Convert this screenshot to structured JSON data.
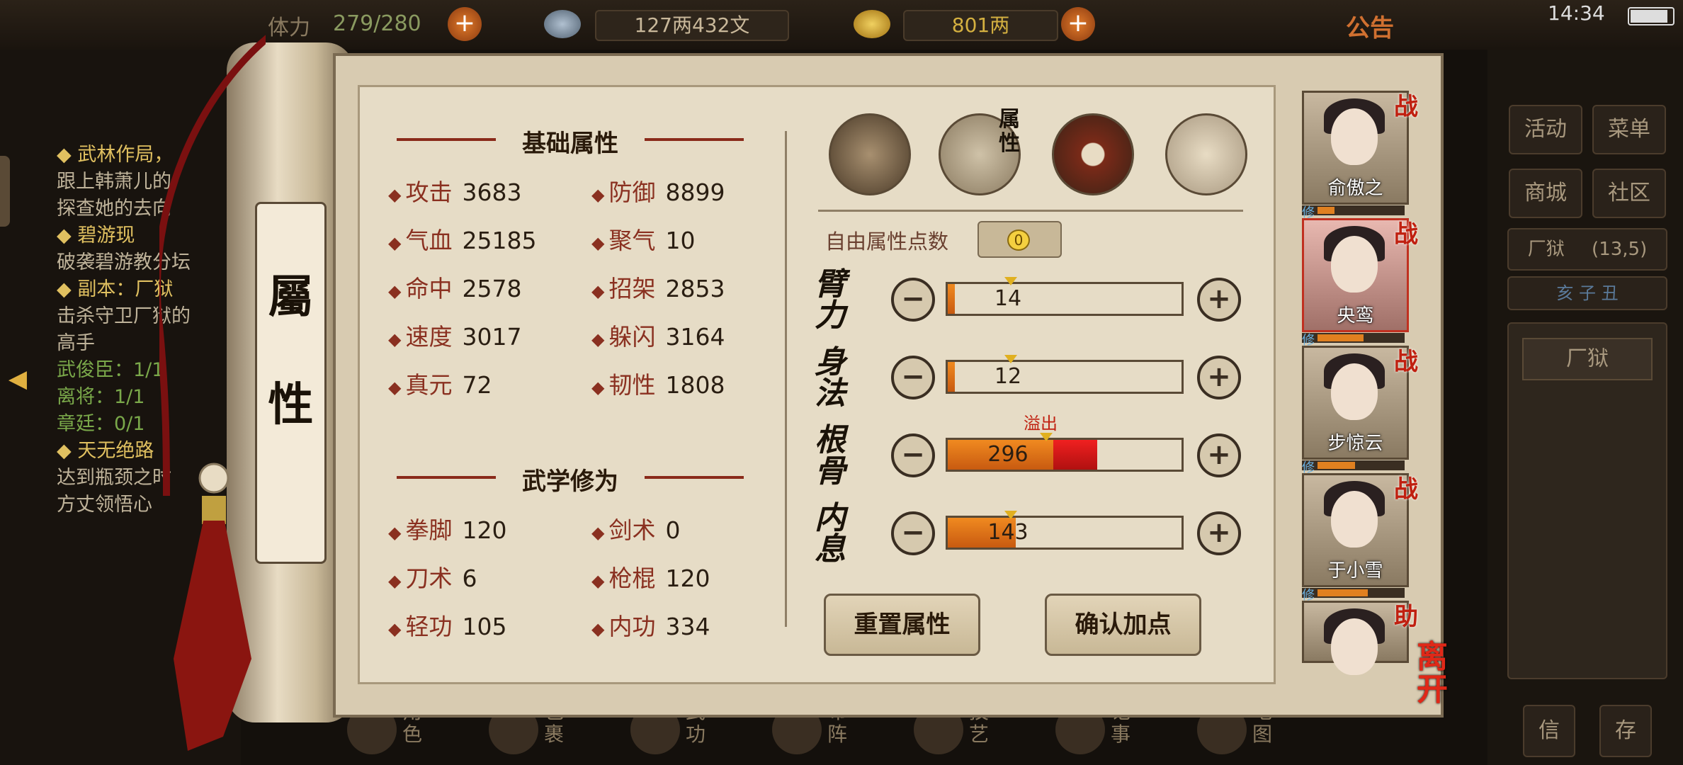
{
  "topbar": {
    "stamina": "279/280",
    "stamina_prefix": "体力",
    "money": "127两432文",
    "gold": "801两",
    "notice": "公告",
    "time": "14:34"
  },
  "bg_log": {
    "lines": [
      {
        "text": "◆ 武林作局，",
        "style": "gold"
      },
      {
        "text": "跟上韩萧儿的",
        "style": "normal"
      },
      {
        "text": "探查她的去向",
        "style": "normal"
      },
      {
        "text": "◆ 碧游现",
        "style": "gold"
      },
      {
        "text": "破袭碧游教分坛",
        "style": "normal"
      },
      {
        "text": "◆ 副本：厂狱",
        "style": "gold"
      },
      {
        "text": "击杀守卫厂狱的",
        "style": "normal"
      },
      {
        "text": "高手",
        "style": "normal"
      },
      {
        "text": "武俊臣：1/1",
        "style": "green"
      },
      {
        "text": "离将：1/1",
        "style": "green"
      },
      {
        "text": "章廷：0/1",
        "style": "green"
      },
      {
        "text": "◆ 天无绝路",
        "style": "gold"
      },
      {
        "text": "达到瓶颈之时",
        "style": "normal"
      },
      {
        "text": "方丈领悟心",
        "style": "normal"
      }
    ]
  },
  "bg_right": {
    "activity": "活动",
    "menu": "菜单",
    "shop": "商城",
    "community": "社区",
    "location": "厂狱",
    "coords": "(13,5)",
    "time_row": "亥 子 丑",
    "map_label": "厂狱",
    "btn_a": "信",
    "btn_b": "存"
  },
  "scroll": {
    "char1": "屬",
    "char2": "性"
  },
  "basic": {
    "title": "基础属性",
    "stats": [
      {
        "name": "攻击",
        "value": "3683"
      },
      {
        "name": "防御",
        "value": "8899"
      },
      {
        "name": "气血",
        "value": "25185"
      },
      {
        "name": "聚气",
        "value": "10"
      },
      {
        "name": "命中",
        "value": "2578"
      },
      {
        "name": "招架",
        "value": "2853"
      },
      {
        "name": "速度",
        "value": "3017"
      },
      {
        "name": "躲闪",
        "value": "3164"
      },
      {
        "name": "真元",
        "value": "72"
      },
      {
        "name": "韧性",
        "value": "1808"
      }
    ]
  },
  "martial": {
    "title": "武学修为",
    "stats": [
      {
        "name": "拳脚",
        "value": "120"
      },
      {
        "name": "剑术",
        "value": "0"
      },
      {
        "name": "刀术",
        "value": "6"
      },
      {
        "name": "枪棍",
        "value": "120"
      },
      {
        "name": "轻功",
        "value": "105"
      },
      {
        "name": "内功",
        "value": "334"
      }
    ]
  },
  "tabs": {
    "attr_tab_label": "属性"
  },
  "free_points": {
    "label": "自由属性点数",
    "value": "0"
  },
  "attributes": [
    {
      "name": "臂力",
      "value": "14",
      "fill": 0.03,
      "over": 0
    },
    {
      "name": "身法",
      "value": "12",
      "fill": 0.03,
      "over": 0
    },
    {
      "name": "根骨",
      "value": "296",
      "fill": 0.45,
      "over": 0.19,
      "overflow_label": "溢出"
    },
    {
      "name": "内息",
      "value": "143",
      "fill": 0.29,
      "over": 0
    }
  ],
  "buttons": {
    "reset": "重置属性",
    "confirm": "确认加点"
  },
  "party": [
    {
      "name": "俞傲之",
      "tag": "战",
      "xiu": "修",
      "progress": 0.2,
      "selected": false
    },
    {
      "name": "央鸾",
      "tag": "战",
      "xiu": "修",
      "progress": 0.55,
      "selected": true
    },
    {
      "name": "步惊云",
      "tag": "战",
      "xiu": "修",
      "progress": 0.45,
      "selected": false
    },
    {
      "name": "于小雪",
      "tag": "战",
      "xiu": "修",
      "progress": 0.6,
      "selected": false
    },
    {
      "name": "",
      "tag": "助",
      "xiu": "",
      "progress": 0,
      "selected": false
    }
  ],
  "leave": "离开",
  "dock": [
    "角色",
    "包裹",
    "武功",
    "布阵",
    "技艺",
    "记事",
    "地图"
  ]
}
